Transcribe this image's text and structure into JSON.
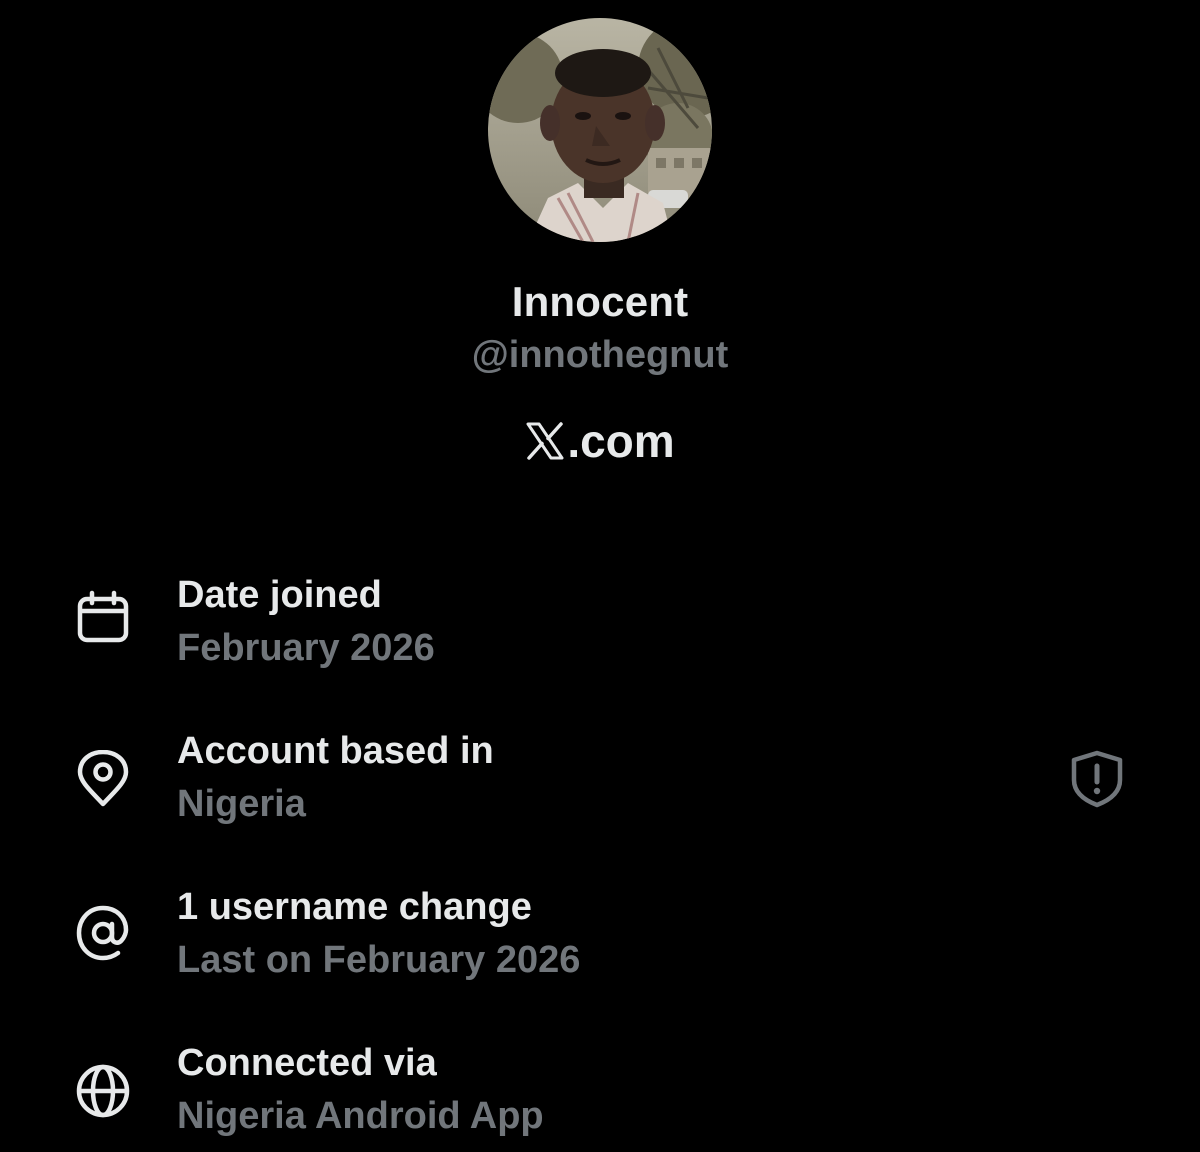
{
  "profile": {
    "display_name": "Innocent",
    "handle": "@innothegnut",
    "source": ".com",
    "source_logo": "x-logo-icon"
  },
  "details": [
    {
      "icon": "calendar-icon",
      "title": "Date joined",
      "value": "February 2026"
    },
    {
      "icon": "location-pin-icon",
      "title": "Account based in",
      "value": "Nigeria",
      "badge_icon": "shield-alert-icon"
    },
    {
      "icon": "at-sign-icon",
      "title": "1 username change",
      "value": "Last on February 2026"
    },
    {
      "icon": "globe-icon",
      "title": "Connected via",
      "value": "Nigeria Android App"
    }
  ],
  "colors": {
    "background": "#000000",
    "primary_text": "#e7e9ea",
    "secondary_text": "#71767b"
  }
}
